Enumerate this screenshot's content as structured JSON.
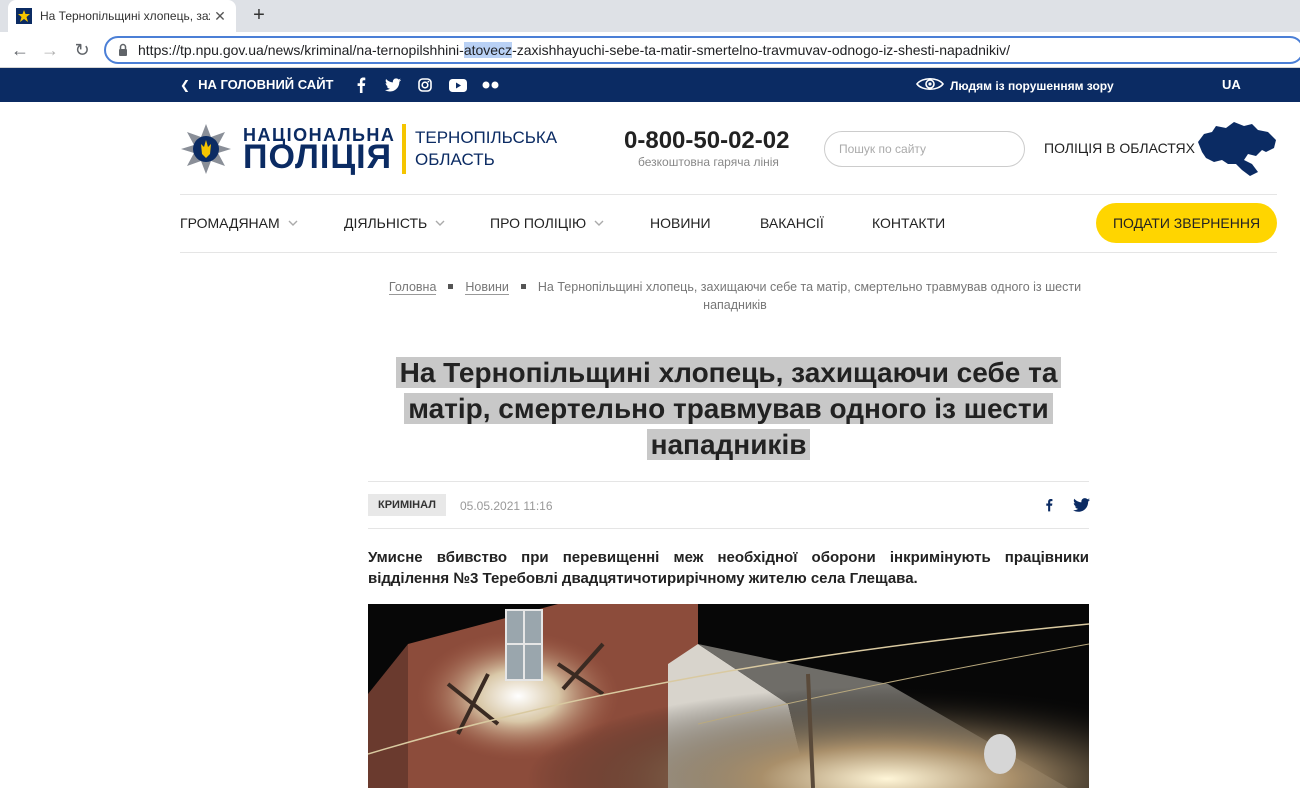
{
  "browser": {
    "tab_title": "На Тернопільщині хлопець, зах",
    "url_before": "https://tp.npu.gov.ua/news/kriminal/na-ternopilshhini-",
    "url_highlight": "atovecz",
    "url_after": "-zaxishhayuchi-sebe-ta-matir-smertelno-travmuvav-odnogo-iz-shesti-napadnikiv/"
  },
  "topbar": {
    "home_label": "НА ГОЛОВНИЙ САЙТ",
    "vision_label": "Людям із порушенням зору",
    "lang": "UA"
  },
  "header": {
    "logo_line1": "НАЦІОНАЛЬНА",
    "logo_line2": "ПОЛІЦІЯ",
    "region_line1": "ТЕРНОПІЛЬСЬКА",
    "region_line2": "ОБЛАСТЬ",
    "hotline": "0-800-50-02-02",
    "hotline_sub": "безкоштовна гаряча лінія",
    "search_placeholder": "Пошук по сайту",
    "regions_link": "ПОЛІЦІЯ В ОБЛАСТЯХ"
  },
  "menu": {
    "items": [
      {
        "label": "ГРОМАДЯНАМ"
      },
      {
        "label": "ДІЯЛЬНІСТЬ"
      },
      {
        "label": "ПРО ПОЛІЦІЮ"
      },
      {
        "label": "НОВИНИ"
      },
      {
        "label": "ВАКАНСІЇ"
      },
      {
        "label": "КОНТАКТИ"
      }
    ],
    "cta": "ПОДАТИ ЗВЕРНЕННЯ"
  },
  "breadcrumb": {
    "home": "Головна",
    "news": "Новини",
    "current": "На Тернопільщині хлопець, захищаючи себе та матір, смертельно травмував одного із шести нападників"
  },
  "article": {
    "title": "На Тернопільщині хлопець, захищаючи себе та матір, смертельно травмував одного із шести нападників",
    "category": "КРИМІНАЛ",
    "date": "05.05.2021 11:16",
    "lead": "Умисне вбивство при перевищенні меж необхідної оборони інкримінують працівники відділення №3 Теребовлі двадцятичотирирічному жителю села Глещава."
  },
  "colors": {
    "brand_blue": "#0b2b63",
    "accent_yellow": "#ffd500",
    "title_highlight": "#c8c8c8"
  }
}
